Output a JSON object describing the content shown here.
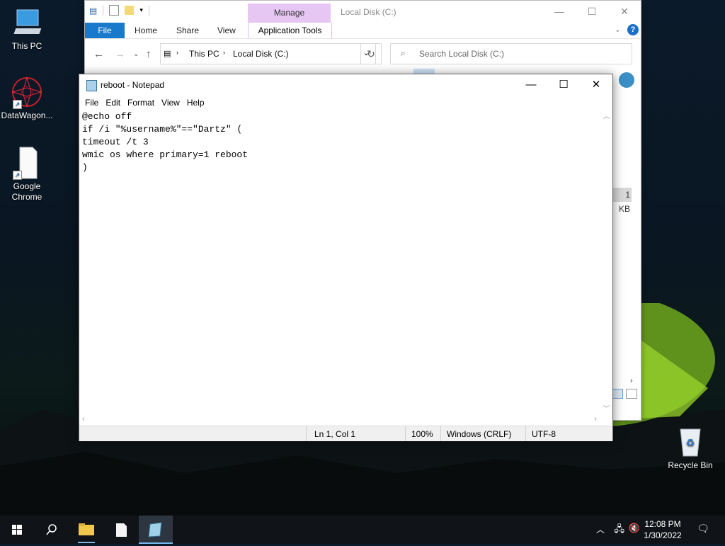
{
  "desktop": {
    "icons": [
      {
        "label": "This PC"
      },
      {
        "label": "DataWagon..."
      },
      {
        "label": "Google Chrome"
      },
      {
        "label": "Recycle Bin"
      }
    ]
  },
  "explorer": {
    "context_tab": "Manage",
    "title": "Local Disk (C:)",
    "ribbon_tabs": [
      "File",
      "Home",
      "Share",
      "View",
      "Application Tools"
    ],
    "breadcrumb": [
      "This PC",
      "Local Disk (C:)"
    ],
    "search_placeholder": "Search Local Disk (C:)",
    "size_fragment": "1 KB"
  },
  "notepad": {
    "title": "reboot - Notepad",
    "menu": [
      "File",
      "Edit",
      "Format",
      "View",
      "Help"
    ],
    "lines": [
      "@echo off",
      "if /i \"%username%\"==\"Dartz\" (",
      "timeout /t 3",
      "wmic os where primary=1 reboot",
      ")"
    ],
    "status": {
      "position": "Ln 1, Col 1",
      "zoom": "100%",
      "line_ending": "Windows (CRLF)",
      "encoding": "UTF-8"
    }
  },
  "taskbar": {
    "time": "12:08 PM",
    "date": "1/30/2022"
  }
}
